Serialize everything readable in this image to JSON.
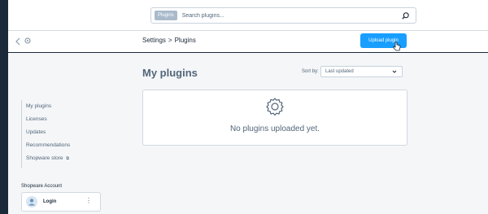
{
  "topbar": {
    "search_pill": "Plugins",
    "search_placeholder": "Search plugins..."
  },
  "subheader": {
    "breadcrumb": [
      "Settings",
      "Plugins"
    ],
    "breadcrumb_separator": ">",
    "upload_label": "Upload plugin"
  },
  "main": {
    "title": "My plugins",
    "sort_label": "Sort by:",
    "sort_value": "Last updated",
    "empty_message": "No plugins uploaded yet."
  },
  "sidebar": {
    "items": [
      {
        "label": "My plugins"
      },
      {
        "label": "Licenses"
      },
      {
        "label": "Updates"
      },
      {
        "label": "Recommendations"
      },
      {
        "label": "Shopware store",
        "external": true
      }
    ]
  },
  "account": {
    "heading": "Shopware Account",
    "login_label": "Login"
  },
  "colors": {
    "accent": "#189eff",
    "dark": "#1b2a3a",
    "text": "#52667a"
  },
  "icons": [
    "search-icon",
    "back-icon",
    "gear-icon",
    "cursor-icon",
    "chevron-down-icon",
    "external-link-icon",
    "avatar-icon",
    "kebab-icon"
  ]
}
